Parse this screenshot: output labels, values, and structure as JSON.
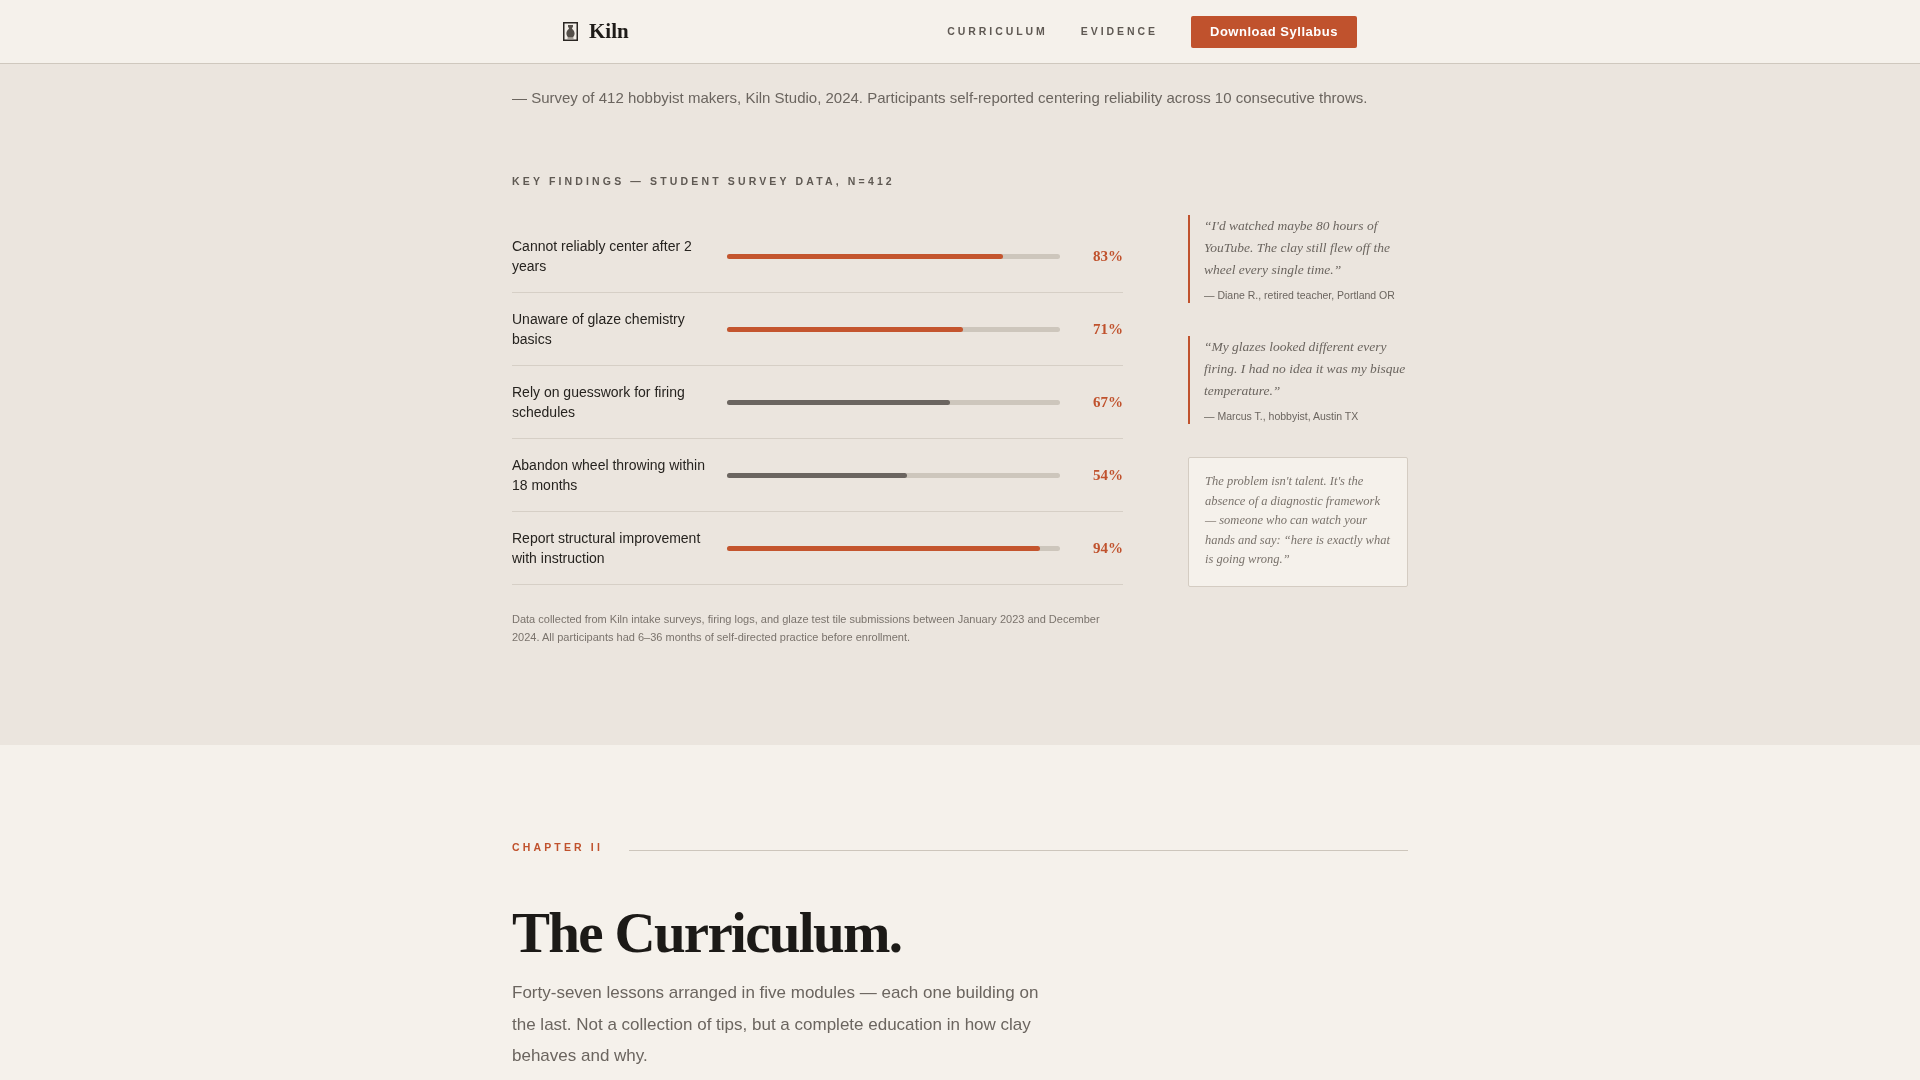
{
  "header": {
    "logo": "Kiln",
    "nav": [
      {
        "label": "CURRICULUM"
      },
      {
        "label": "EVIDENCE"
      }
    ],
    "cta": "Download Syllabus"
  },
  "evidence": {
    "source_note": "— Survey of 412 hobbyist makers, Kiln Studio, 2024. Participants self-reported centering reliability across 10 consecutive throws.",
    "findings_title": "KEY FINDINGS — STUDENT SURVEY DATA, N=412",
    "findings": [
      {
        "label": "Cannot reliably center after 2 years",
        "level": 0.83,
        "reading": "83%",
        "color": "#c4552e"
      },
      {
        "label": "Unaware of glaze chemistry basics",
        "level": 0.71,
        "reading": "71%",
        "color": "#c4552e"
      },
      {
        "label": "Rely on guesswork for firing schedules",
        "level": 0.67,
        "reading": "67%",
        "color": "#6b6560"
      },
      {
        "label": "Abandon wheel throwing within 18 months",
        "level": 0.54,
        "reading": "54%",
        "color": "#6b6560"
      },
      {
        "label": "Report structural improvement with instruction",
        "level": 0.94,
        "reading": "94%",
        "color": "#c4552e"
      }
    ],
    "footnote": "Data collected from Kiln intake surveys, firing logs, and glaze test tile submissions between January 2023 and December 2024. All participants had 6–36 months of self-directed practice before enrollment.",
    "quotes": [
      {
        "text": "“I'd watched maybe 80 hours of YouTube. The clay still flew off the wheel every single time.”",
        "attribution": "— Diane R., retired teacher, Portland OR"
      },
      {
        "text": "“My glazes looked different every firing. I had no idea it was my bisque temperature.”",
        "attribution": "— Marcus T., hobbyist, Austin TX"
      }
    ],
    "callout": "The problem isn't talent. It's the absence of a diagnostic framework — someone who can watch your hands and say: “here is exactly what is going wrong.”"
  },
  "curriculum": {
    "chapter_label": "CHAPTER II",
    "heading": "The Curriculum.",
    "intro": "Forty-seven lessons arranged in five modules — each one building on the last. Not a collection of tips, but a complete education in how clay behaves and why."
  }
}
